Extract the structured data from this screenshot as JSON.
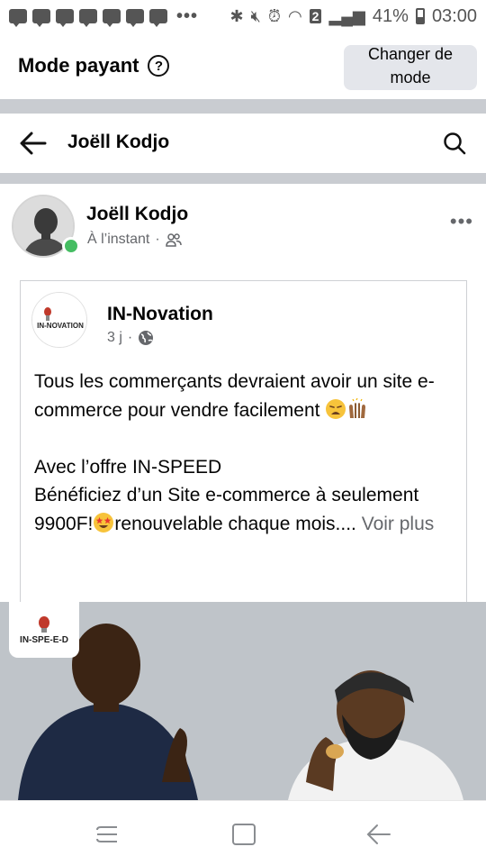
{
  "status_bar": {
    "battery": "41%",
    "time": "03:00",
    "sim_badge": "2",
    "notification_icons": [
      "message-icon",
      "message-icon",
      "message-icon",
      "message-icon",
      "message-icon",
      "message-icon",
      "message-icon"
    ],
    "overflow": "•••"
  },
  "mode_bar": {
    "title": "Mode payant",
    "help_icon": "?",
    "switch_button_line1": "Changer de",
    "switch_button_line2": "mode"
  },
  "header": {
    "title": "Joëll Kodjo"
  },
  "post": {
    "author": "Joëll Kodjo",
    "time": "À l’instant",
    "separator": "·",
    "audience_icon": "friends-icon",
    "shared": {
      "page_name": "IN-Novation",
      "avatar_text": "IN-NOVATION",
      "time": "3 j",
      "separator": "·",
      "audience_icon": "globe-icon",
      "text_line1": "Tous les commerçants devraient avoir un site e-commerce pour vendre facilement",
      "text_line2": "Avec l’offre IN-SPEED",
      "text_line3": "Bénéficiez d’un Site e-commerce à seulement 9900F!",
      "text_line3b": "renouvelable chaque mois....",
      "see_more": "Voir plus"
    },
    "photo_badge": "IN-SPE-E-D"
  },
  "colors": {
    "online": "#45bd62",
    "button_bg": "#e4e6eb",
    "divider": "#c9ccd1",
    "secondary_text": "#65676b"
  }
}
